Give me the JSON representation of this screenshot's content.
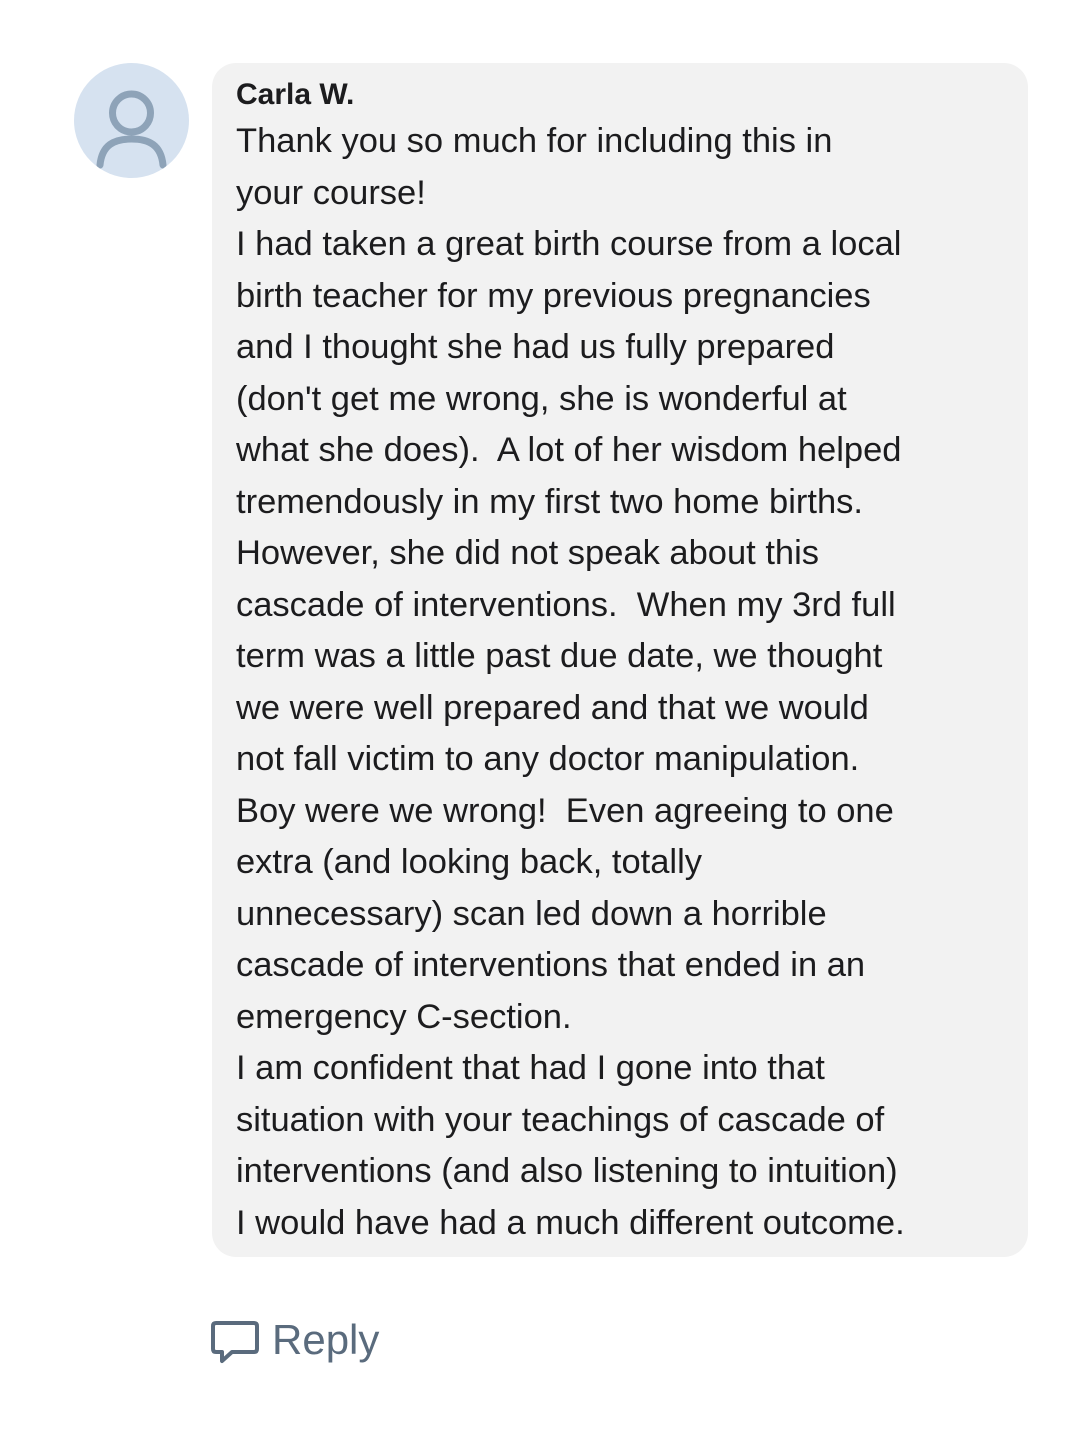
{
  "comment": {
    "avatar_icon": "user-icon",
    "author": "Carla W.",
    "lines": [
      "Thank you so much for including this in",
      "your course!",
      "I had taken a great birth course from a local",
      "birth teacher for my previous pregnancies",
      "and I thought she had us fully prepared",
      "(don't get me wrong, she is wonderful at",
      "what she does).  A lot of her wisdom helped",
      "tremendously in my first two home births.",
      "However, she did not speak about this",
      "cascade of interventions.  When my 3rd full",
      "term was a little past due date, we thought",
      "we were well prepared and that we would",
      "not fall victim to any doctor manipulation.",
      "Boy were we wrong!  Even agreeing to one",
      "extra (and looking back, totally",
      "unnecessary) scan led down a horrible",
      "cascade of interventions that ended in an",
      "emergency C-section.",
      "I am confident that had I gone into that",
      "situation with your teachings of cascade of",
      "interventions (and also listening to intuition)",
      "I would have had a much different outcome."
    ]
  },
  "actions": {
    "reply_icon": "speech-bubble-icon",
    "reply_label": "Reply"
  },
  "colors": {
    "bubble_bg": "#f2f2f2",
    "avatar_bg": "#d6e2f0",
    "avatar_glyph": "#8ea3b8",
    "reply_text": "#5a6b7d",
    "body_text": "#1c1c1e"
  }
}
